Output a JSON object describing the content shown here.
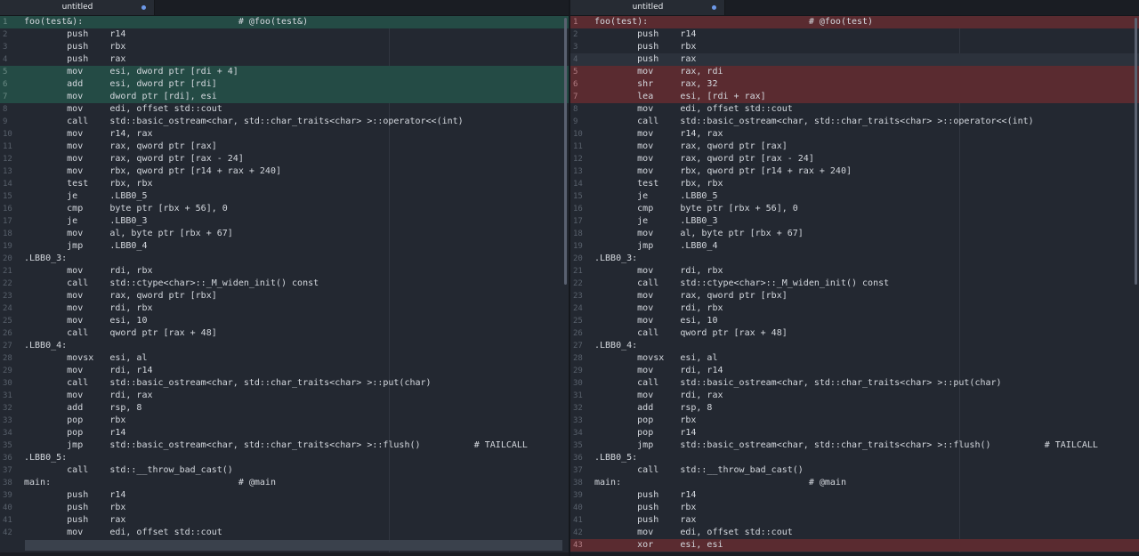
{
  "left_pane": {
    "tab": {
      "label": "untitled"
    },
    "lines": [
      {
        "n": "1",
        "text": "foo(test&):                             # @foo(test&)",
        "state": "added"
      },
      {
        "n": "2",
        "text": "        push    r14",
        "state": ""
      },
      {
        "n": "3",
        "text": "        push    rbx",
        "state": ""
      },
      {
        "n": "4",
        "text": "        push    rax",
        "state": ""
      },
      {
        "n": "5",
        "text": "        mov     esi, dword ptr [rdi + 4]",
        "state": "added"
      },
      {
        "n": "6",
        "text": "        add     esi, dword ptr [rdi]",
        "state": "added"
      },
      {
        "n": "7",
        "text": "        mov     dword ptr [rdi], esi",
        "state": "added"
      },
      {
        "n": "8",
        "text": "        mov     edi, offset std::cout",
        "state": ""
      },
      {
        "n": "9",
        "text": "        call    std::basic_ostream<char, std::char_traits<char> >::operator<<(int)",
        "state": ""
      },
      {
        "n": "10",
        "text": "        mov     r14, rax",
        "state": ""
      },
      {
        "n": "11",
        "text": "        mov     rax, qword ptr [rax]",
        "state": ""
      },
      {
        "n": "12",
        "text": "        mov     rax, qword ptr [rax - 24]",
        "state": ""
      },
      {
        "n": "13",
        "text": "        mov     rbx, qword ptr [r14 + rax + 240]",
        "state": ""
      },
      {
        "n": "14",
        "text": "        test    rbx, rbx",
        "state": ""
      },
      {
        "n": "15",
        "text": "        je      .LBB0_5",
        "state": ""
      },
      {
        "n": "16",
        "text": "        cmp     byte ptr [rbx + 56], 0",
        "state": ""
      },
      {
        "n": "17",
        "text": "        je      .LBB0_3",
        "state": ""
      },
      {
        "n": "18",
        "text": "        mov     al, byte ptr [rbx + 67]",
        "state": ""
      },
      {
        "n": "19",
        "text": "        jmp     .LBB0_4",
        "state": ""
      },
      {
        "n": "20",
        "text": ".LBB0_3:",
        "state": ""
      },
      {
        "n": "21",
        "text": "        mov     rdi, rbx",
        "state": ""
      },
      {
        "n": "22",
        "text": "        call    std::ctype<char>::_M_widen_init() const",
        "state": ""
      },
      {
        "n": "23",
        "text": "        mov     rax, qword ptr [rbx]",
        "state": ""
      },
      {
        "n": "24",
        "text": "        mov     rdi, rbx",
        "state": ""
      },
      {
        "n": "25",
        "text": "        mov     esi, 10",
        "state": ""
      },
      {
        "n": "26",
        "text": "        call    qword ptr [rax + 48]",
        "state": ""
      },
      {
        "n": "27",
        "text": ".LBB0_4:",
        "state": ""
      },
      {
        "n": "28",
        "text": "        movsx   esi, al",
        "state": ""
      },
      {
        "n": "29",
        "text": "        mov     rdi, r14",
        "state": ""
      },
      {
        "n": "30",
        "text": "        call    std::basic_ostream<char, std::char_traits<char> >::put(char)",
        "state": ""
      },
      {
        "n": "31",
        "text": "        mov     rdi, rax",
        "state": ""
      },
      {
        "n": "32",
        "text": "        add     rsp, 8",
        "state": ""
      },
      {
        "n": "33",
        "text": "        pop     rbx",
        "state": ""
      },
      {
        "n": "34",
        "text": "        pop     r14",
        "state": ""
      },
      {
        "n": "35",
        "text": "        jmp     std::basic_ostream<char, std::char_traits<char> >::flush()          # TAILCALL",
        "state": ""
      },
      {
        "n": "36",
        "text": ".LBB0_5:",
        "state": ""
      },
      {
        "n": "37",
        "text": "        call    std::__throw_bad_cast()",
        "state": ""
      },
      {
        "n": "38",
        "text": "main:                                   # @main",
        "state": ""
      },
      {
        "n": "39",
        "text": "        push    r14",
        "state": ""
      },
      {
        "n": "40",
        "text": "        push    rbx",
        "state": ""
      },
      {
        "n": "41",
        "text": "        push    rax",
        "state": ""
      },
      {
        "n": "42",
        "text": "        mov     edi, offset std::cout",
        "state": ""
      }
    ]
  },
  "right_pane": {
    "tab": {
      "label": "untitled"
    },
    "lines": [
      {
        "n": "1",
        "text": "foo(test):                              # @foo(test)",
        "state": "removed"
      },
      {
        "n": "2",
        "text": "        push    r14",
        "state": ""
      },
      {
        "n": "3",
        "text": "        push    rbx",
        "state": ""
      },
      {
        "n": "4",
        "text": "        push    rax",
        "state": "current"
      },
      {
        "n": "5",
        "text": "        mov     rax, rdi",
        "state": "removed"
      },
      {
        "n": "6",
        "text": "        shr     rax, 32",
        "state": "removed"
      },
      {
        "n": "7",
        "text": "        lea     esi, [rdi + rax]",
        "state": "removed"
      },
      {
        "n": "8",
        "text": "        mov     edi, offset std::cout",
        "state": ""
      },
      {
        "n": "9",
        "text": "        call    std::basic_ostream<char, std::char_traits<char> >::operator<<(int)",
        "state": ""
      },
      {
        "n": "10",
        "text": "        mov     r14, rax",
        "state": ""
      },
      {
        "n": "11",
        "text": "        mov     rax, qword ptr [rax]",
        "state": ""
      },
      {
        "n": "12",
        "text": "        mov     rax, qword ptr [rax - 24]",
        "state": ""
      },
      {
        "n": "13",
        "text": "        mov     rbx, qword ptr [r14 + rax + 240]",
        "state": ""
      },
      {
        "n": "14",
        "text": "        test    rbx, rbx",
        "state": ""
      },
      {
        "n": "15",
        "text": "        je      .LBB0_5",
        "state": ""
      },
      {
        "n": "16",
        "text": "        cmp     byte ptr [rbx + 56], 0",
        "state": ""
      },
      {
        "n": "17",
        "text": "        je      .LBB0_3",
        "state": ""
      },
      {
        "n": "18",
        "text": "        mov     al, byte ptr [rbx + 67]",
        "state": ""
      },
      {
        "n": "19",
        "text": "        jmp     .LBB0_4",
        "state": ""
      },
      {
        "n": "20",
        "text": ".LBB0_3:",
        "state": ""
      },
      {
        "n": "21",
        "text": "        mov     rdi, rbx",
        "state": ""
      },
      {
        "n": "22",
        "text": "        call    std::ctype<char>::_M_widen_init() const",
        "state": ""
      },
      {
        "n": "23",
        "text": "        mov     rax, qword ptr [rbx]",
        "state": ""
      },
      {
        "n": "24",
        "text": "        mov     rdi, rbx",
        "state": ""
      },
      {
        "n": "25",
        "text": "        mov     esi, 10",
        "state": ""
      },
      {
        "n": "26",
        "text": "        call    qword ptr [rax + 48]",
        "state": ""
      },
      {
        "n": "27",
        "text": ".LBB0_4:",
        "state": ""
      },
      {
        "n": "28",
        "text": "        movsx   esi, al",
        "state": ""
      },
      {
        "n": "29",
        "text": "        mov     rdi, r14",
        "state": ""
      },
      {
        "n": "30",
        "text": "        call    std::basic_ostream<char, std::char_traits<char> >::put(char)",
        "state": ""
      },
      {
        "n": "31",
        "text": "        mov     rdi, rax",
        "state": ""
      },
      {
        "n": "32",
        "text": "        add     rsp, 8",
        "state": ""
      },
      {
        "n": "33",
        "text": "        pop     rbx",
        "state": ""
      },
      {
        "n": "34",
        "text": "        pop     r14",
        "state": ""
      },
      {
        "n": "35",
        "text": "        jmp     std::basic_ostream<char, std::char_traits<char> >::flush()          # TAILCALL",
        "state": ""
      },
      {
        "n": "36",
        "text": ".LBB0_5:",
        "state": ""
      },
      {
        "n": "37",
        "text": "        call    std::__throw_bad_cast()",
        "state": ""
      },
      {
        "n": "38",
        "text": "main:                                   # @main",
        "state": ""
      },
      {
        "n": "39",
        "text": "        push    r14",
        "state": ""
      },
      {
        "n": "40",
        "text": "        push    rbx",
        "state": ""
      },
      {
        "n": "41",
        "text": "        push    rax",
        "state": ""
      },
      {
        "n": "42",
        "text": "        mov     edi, offset std::cout",
        "state": ""
      },
      {
        "n": "43",
        "text": "        xor     esi, esi",
        "state": "removed"
      }
    ]
  },
  "colors": {
    "added": "#244b45",
    "removed": "#5a2b30",
    "modified_dot": "#6d99e8",
    "background": "#232831"
  }
}
